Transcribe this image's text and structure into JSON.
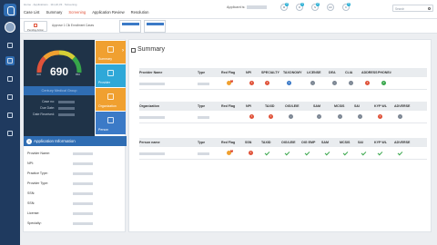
{
  "topbar": {
    "breadcrumb": "Home · Applications · 111,22,33 · Screening",
    "tabs": [
      {
        "label": "Case List",
        "active": false
      },
      {
        "label": "Summary",
        "active": false
      },
      {
        "label": "Screening",
        "active": true
      },
      {
        "label": "Application Review",
        "active": false
      },
      {
        "label": "Resolution",
        "active": false
      }
    ],
    "applicant_label": "Applicant is:",
    "status_circles": [
      {
        "label": "M",
        "badge": "3"
      },
      {
        "label": "D",
        "badge": "1"
      },
      {
        "label": "N",
        "badge": "2"
      },
      {
        "label": "AC",
        "badge": ""
      },
      {
        "label": "K",
        "badge": "5"
      }
    ],
    "search_placeholder": "Search",
    "notification_count": "1"
  },
  "subbar": {
    "pending_action": "Pending Action",
    "approve_text": "Approve 1 Clk Enrollment Cases"
  },
  "score_card": {
    "score": "690",
    "min_label": "300",
    "max_label": "850",
    "provider_name": "Century Medical Group",
    "meta": [
      {
        "label": "Case no:"
      },
      {
        "label": "Due Date:"
      },
      {
        "label": "Date Received:"
      }
    ]
  },
  "side_tabs": [
    {
      "label": "Summary",
      "color": "#f0a030",
      "active": true
    },
    {
      "label": "Provider",
      "color": "#2fa8d8",
      "active": false
    },
    {
      "label": "Organization",
      "color": "#f0a030",
      "active": false
    },
    {
      "label": "Person",
      "color": "#3b7ac7",
      "active": false
    }
  ],
  "application_info": {
    "title": "Application Information",
    "rows": [
      {
        "label": "Provider Name:"
      },
      {
        "label": "NPI:"
      },
      {
        "label": "Practice Type:"
      },
      {
        "label": "Provider Type:"
      },
      {
        "label": "SSN:"
      },
      {
        "label": "SSN:"
      },
      {
        "label": "License:"
      },
      {
        "label": "Specialty:"
      }
    ]
  },
  "summary": {
    "title": "Summary",
    "provider_table": {
      "headers": [
        "Provider Name",
        "Type",
        "Red Flag",
        "NPI",
        "SPECIALTY",
        "TAXONOMY",
        "LICENSE",
        "DEA",
        "CLIA",
        "ADDRESS",
        "PHONE#"
      ],
      "row": {
        "red_flag_count": "3",
        "statuses": [
          {
            "kind": "red",
            "text": "!"
          },
          {
            "kind": "red",
            "text": "!"
          },
          {
            "kind": "blue",
            "text": "i"
          },
          {
            "kind": "grey",
            "text": "-"
          },
          {
            "kind": "grey",
            "text": "-"
          },
          {
            "kind": "grey",
            "text": "-"
          },
          {
            "kind": "red",
            "text": "!"
          },
          {
            "kind": "green",
            "text": "✓"
          }
        ]
      }
    },
    "organization_table": {
      "headers": [
        "Organization",
        "Type",
        "Red Flag",
        "NPI",
        "TAXID",
        "OIG/LEIE",
        "SAM",
        "MCSIS",
        "S&I",
        "KYP WL",
        "ADVERSE"
      ],
      "row": {
        "red_flag_count": "",
        "statuses": [
          {
            "kind": "red",
            "text": "!"
          },
          {
            "kind": "red",
            "text": "!"
          },
          {
            "kind": "grey",
            "text": "-"
          },
          {
            "kind": "grey",
            "text": "-"
          },
          {
            "kind": "grey",
            "text": "-"
          },
          {
            "kind": "grey",
            "text": "-"
          },
          {
            "kind": "red",
            "text": "!"
          },
          {
            "kind": "grey",
            "text": "-"
          }
        ]
      }
    },
    "person_table": {
      "headers": [
        "Person name",
        "Type",
        "Red Flag",
        "SSN",
        "TAXID",
        "OIG/LEIE",
        "OIG EMP",
        "SAM",
        "MCSIS",
        "S&I",
        "KYP WL",
        "ADVERSE"
      ],
      "row": {
        "red_flag_count": "3",
        "statuses": [
          {
            "kind": "red",
            "text": "!"
          },
          {
            "kind": "check"
          },
          {
            "kind": "check"
          },
          {
            "kind": "check"
          },
          {
            "kind": "check"
          },
          {
            "kind": "check"
          },
          {
            "kind": "check"
          },
          {
            "kind": "check"
          },
          {
            "kind": "check"
          }
        ]
      }
    }
  }
}
